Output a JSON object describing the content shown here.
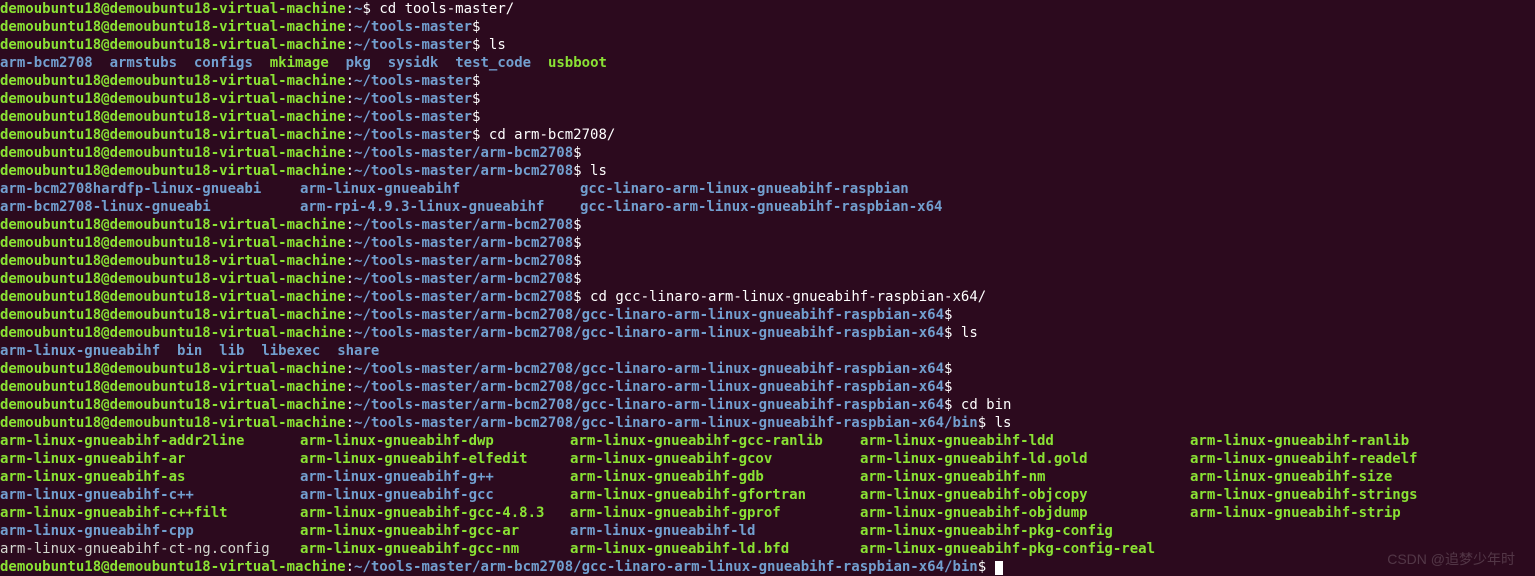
{
  "user": "demoubuntu18@demoubuntu18-virtual-machine",
  "sep": ":",
  "dollar": "$",
  "paths": {
    "home": "~",
    "tools": "~/tools-master",
    "arm": "~/tools-master/arm-bcm2708",
    "ras": "~/tools-master/arm-bcm2708/gcc-linaro-arm-linux-gnueabihf-raspbian-x64",
    "bin": "~/tools-master/arm-bcm2708/gcc-linaro-arm-linux-gnueabihf-raspbian-x64/bin"
  },
  "cmds": {
    "cd_tools": " cd tools-master/",
    "ls": " ls",
    "cd_arm": " cd arm-bcm2708/",
    "cd_ras": " cd gcc-linaro-arm-linux-gnueabihf-raspbian-x64/",
    "cd_bin": " cd bin"
  },
  "ls_tools": {
    "dirs": [
      "arm-bcm2708",
      "armstubs",
      "configs"
    ],
    "exes": [
      "mkimage"
    ],
    "dirs2": [
      "pkg",
      "sysidk",
      "test_code"
    ],
    "exes2": [
      "usbboot"
    ]
  },
  "ls_arm": [
    [
      "arm-bcm2708hardfp-linux-gnueabi",
      "arm-linux-gnueabihf",
      "gcc-linaro-arm-linux-gnueabihf-raspbian"
    ],
    [
      "arm-bcm2708-linux-gnueabi",
      "arm-rpi-4.9.3-linux-gnueabihf",
      "gcc-linaro-arm-linux-gnueabihf-raspbian-x64"
    ]
  ],
  "ls_ras": [
    "arm-linux-gnueabihf",
    "bin",
    "lib",
    "libexec",
    "share"
  ],
  "ls_bin": [
    [
      "arm-linux-gnueabihf-addr2line",
      "arm-linux-gnueabihf-dwp",
      "arm-linux-gnueabihf-gcc-ranlib",
      "arm-linux-gnueabihf-ldd",
      "arm-linux-gnueabihf-ranlib"
    ],
    [
      "arm-linux-gnueabihf-ar",
      "arm-linux-gnueabihf-elfedit",
      "arm-linux-gnueabihf-gcov",
      "arm-linux-gnueabihf-ld.gold",
      "arm-linux-gnueabihf-readelf"
    ],
    [
      "arm-linux-gnueabihf-as",
      "arm-linux-gnueabihf-g++",
      "arm-linux-gnueabihf-gdb",
      "arm-linux-gnueabihf-nm",
      "arm-linux-gnueabihf-size"
    ],
    [
      "arm-linux-gnueabihf-c++",
      "arm-linux-gnueabihf-gcc",
      "arm-linux-gnueabihf-gfortran",
      "arm-linux-gnueabihf-objcopy",
      "arm-linux-gnueabihf-strings"
    ],
    [
      "arm-linux-gnueabihf-c++filt",
      "arm-linux-gnueabihf-gcc-4.8.3",
      "arm-linux-gnueabihf-gprof",
      "arm-linux-gnueabihf-objdump",
      "arm-linux-gnueabihf-strip"
    ],
    [
      "arm-linux-gnueabihf-cpp",
      "arm-linux-gnueabihf-gcc-ar",
      "arm-linux-gnueabihf-ld",
      "arm-linux-gnueabihf-pkg-config",
      ""
    ],
    [
      "arm-linux-gnueabihf-ct-ng.config",
      "arm-linux-gnueabihf-gcc-nm",
      "arm-linux-gnueabihf-ld.bfd",
      "arm-linux-gnueabihf-pkg-config-real",
      ""
    ]
  ],
  "bin_types": [
    [
      "exe",
      "exe",
      "exe",
      "exe",
      "exe"
    ],
    [
      "exe",
      "exe",
      "exe",
      "exe",
      "exe"
    ],
    [
      "exe",
      "dir",
      "exe",
      "exe",
      "exe"
    ],
    [
      "dir",
      "dir",
      "exe",
      "exe",
      "exe"
    ],
    [
      "exe",
      "exe",
      "exe",
      "exe",
      "exe"
    ],
    [
      "dir",
      "exe",
      "dir",
      "exe",
      ""
    ],
    [
      "file",
      "exe",
      "exe",
      "exe",
      ""
    ]
  ],
  "watermark": "CSDN @追梦少年时"
}
